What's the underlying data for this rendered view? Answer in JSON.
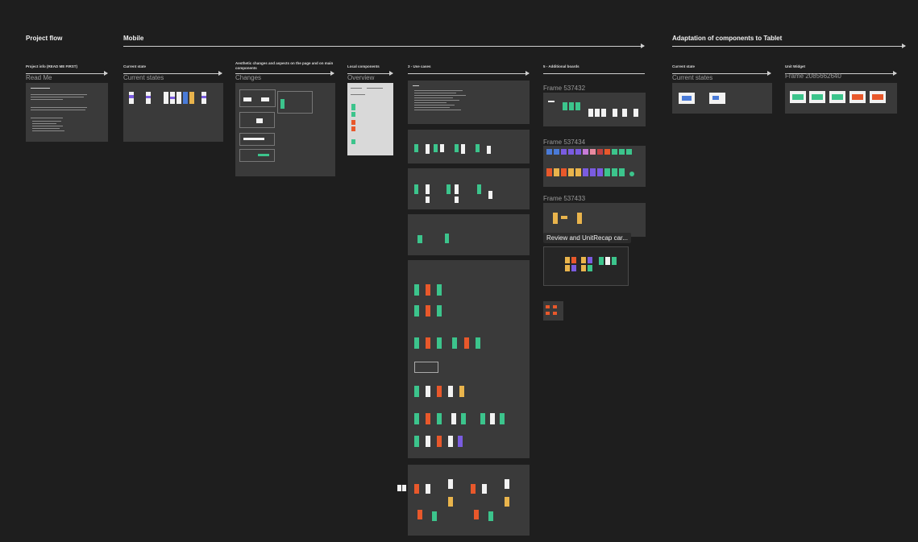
{
  "sections": {
    "project_flow": "Project flow",
    "mobile": "Mobile",
    "tablet": "Adaptation of components to Tablet"
  },
  "columns": {
    "project_info": {
      "label": "Project info (READ ME FIRST)",
      "frame": "Read Me"
    },
    "current_state": {
      "label": "Current state",
      "frame": "Current states"
    },
    "aesthetic": {
      "label": "Aesthetic changes and aspects on the page and on main components",
      "frame": "Changes"
    },
    "local_components": {
      "label": "Local components",
      "frame": "Overview"
    },
    "use_cases": {
      "label": "3 - Use cases"
    },
    "additional_boards": {
      "label": "5 - Additional boards",
      "frames": [
        "Frame 537432",
        "Frame 537434",
        "Frame 537433"
      ]
    },
    "tablet_current_state": {
      "label": "Current state",
      "frame": "Current states"
    },
    "unit_widget": {
      "label": "Unit Widget",
      "frame": "Frame 2085662640"
    }
  },
  "tooltip": "Review and UnitRecap car..."
}
